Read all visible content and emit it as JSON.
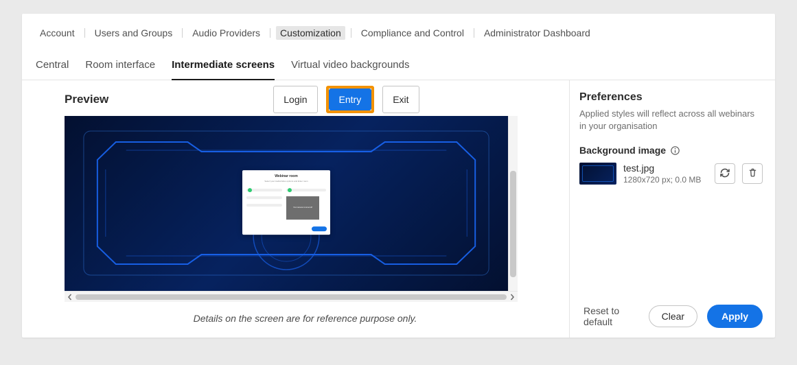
{
  "topnav": {
    "items": [
      "Account",
      "Users and Groups",
      "Audio Providers",
      "Customization",
      "Compliance and Control",
      "Administrator Dashboard"
    ],
    "active_index": 3
  },
  "tabs": {
    "items": [
      "Central",
      "Room interface",
      "Intermediate screens",
      "Virtual video backgrounds"
    ],
    "active_index": 2
  },
  "preview": {
    "title": "Preview",
    "toggles": {
      "login": "Login",
      "entry": "Entry",
      "exit": "Exit"
    },
    "caption": "Details on the screen are for reference purpose only.",
    "modal": {
      "title": "Webinar room",
      "subtitle": "Select your Audio/video options and Enter room",
      "camera_off": "Your camera is turned off"
    }
  },
  "preferences": {
    "title": "Preferences",
    "help": "Applied styles will reflect across all webinars in your organisation",
    "bg_label": "Background image",
    "file": {
      "name": "test.jpg",
      "meta": "1280x720 px; 0.0 MB"
    }
  },
  "actions": {
    "reset": "Reset to default",
    "clear": "Clear",
    "apply": "Apply"
  }
}
